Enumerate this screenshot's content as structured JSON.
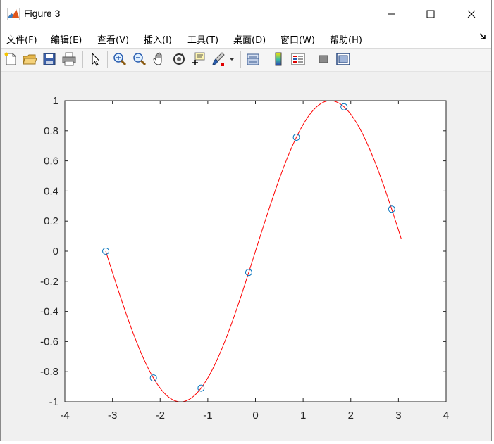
{
  "window": {
    "title": "Figure 3"
  },
  "menu": [
    {
      "label": "文件(F)"
    },
    {
      "label": "编辑(E)"
    },
    {
      "label": "查看(V)"
    },
    {
      "label": "插入(I)"
    },
    {
      "label": "工具(T)"
    },
    {
      "label": "桌面(D)"
    },
    {
      "label": "窗口(W)"
    },
    {
      "label": "帮助(H)"
    }
  ],
  "toolbar": [
    "new-figure-icon",
    "open-file-icon",
    "save-icon",
    "print-icon",
    "pointer-icon",
    "zoom-in-icon",
    "zoom-out-icon",
    "pan-hand-icon",
    "rotate-3d-icon",
    "data-cursor-icon",
    "brush-icon",
    "link-plot-icon",
    "colorbar-icon",
    "legend-icon",
    "hide-plot-tools-icon",
    "show-plot-tools-icon"
  ],
  "chart_data": {
    "type": "line",
    "title": "",
    "xlabel": "",
    "ylabel": "",
    "xlim": [
      -4,
      4
    ],
    "ylim": [
      -1,
      1
    ],
    "xticks": [
      -4,
      -3,
      -2,
      -1,
      0,
      1,
      2,
      3,
      4
    ],
    "yticks": [
      -1,
      -0.8,
      -0.6,
      -0.4,
      -0.2,
      0,
      0.2,
      0.4,
      0.6,
      0.8,
      1
    ],
    "grid": false,
    "series": [
      {
        "kind": "markers",
        "marker": "circle",
        "color": "#0072BD",
        "x": [
          -3.1416,
          -2.1416,
          -1.1416,
          -0.1416,
          0.8584,
          1.8584,
          2.8584
        ],
        "y": [
          0.0,
          -0.8415,
          -0.9093,
          -0.1411,
          0.7568,
          0.9589,
          0.2794
        ]
      },
      {
        "kind": "line",
        "color": "#FF0000",
        "function": "sin",
        "x_range": [
          -3.1416,
          3.0584
        ]
      }
    ]
  }
}
